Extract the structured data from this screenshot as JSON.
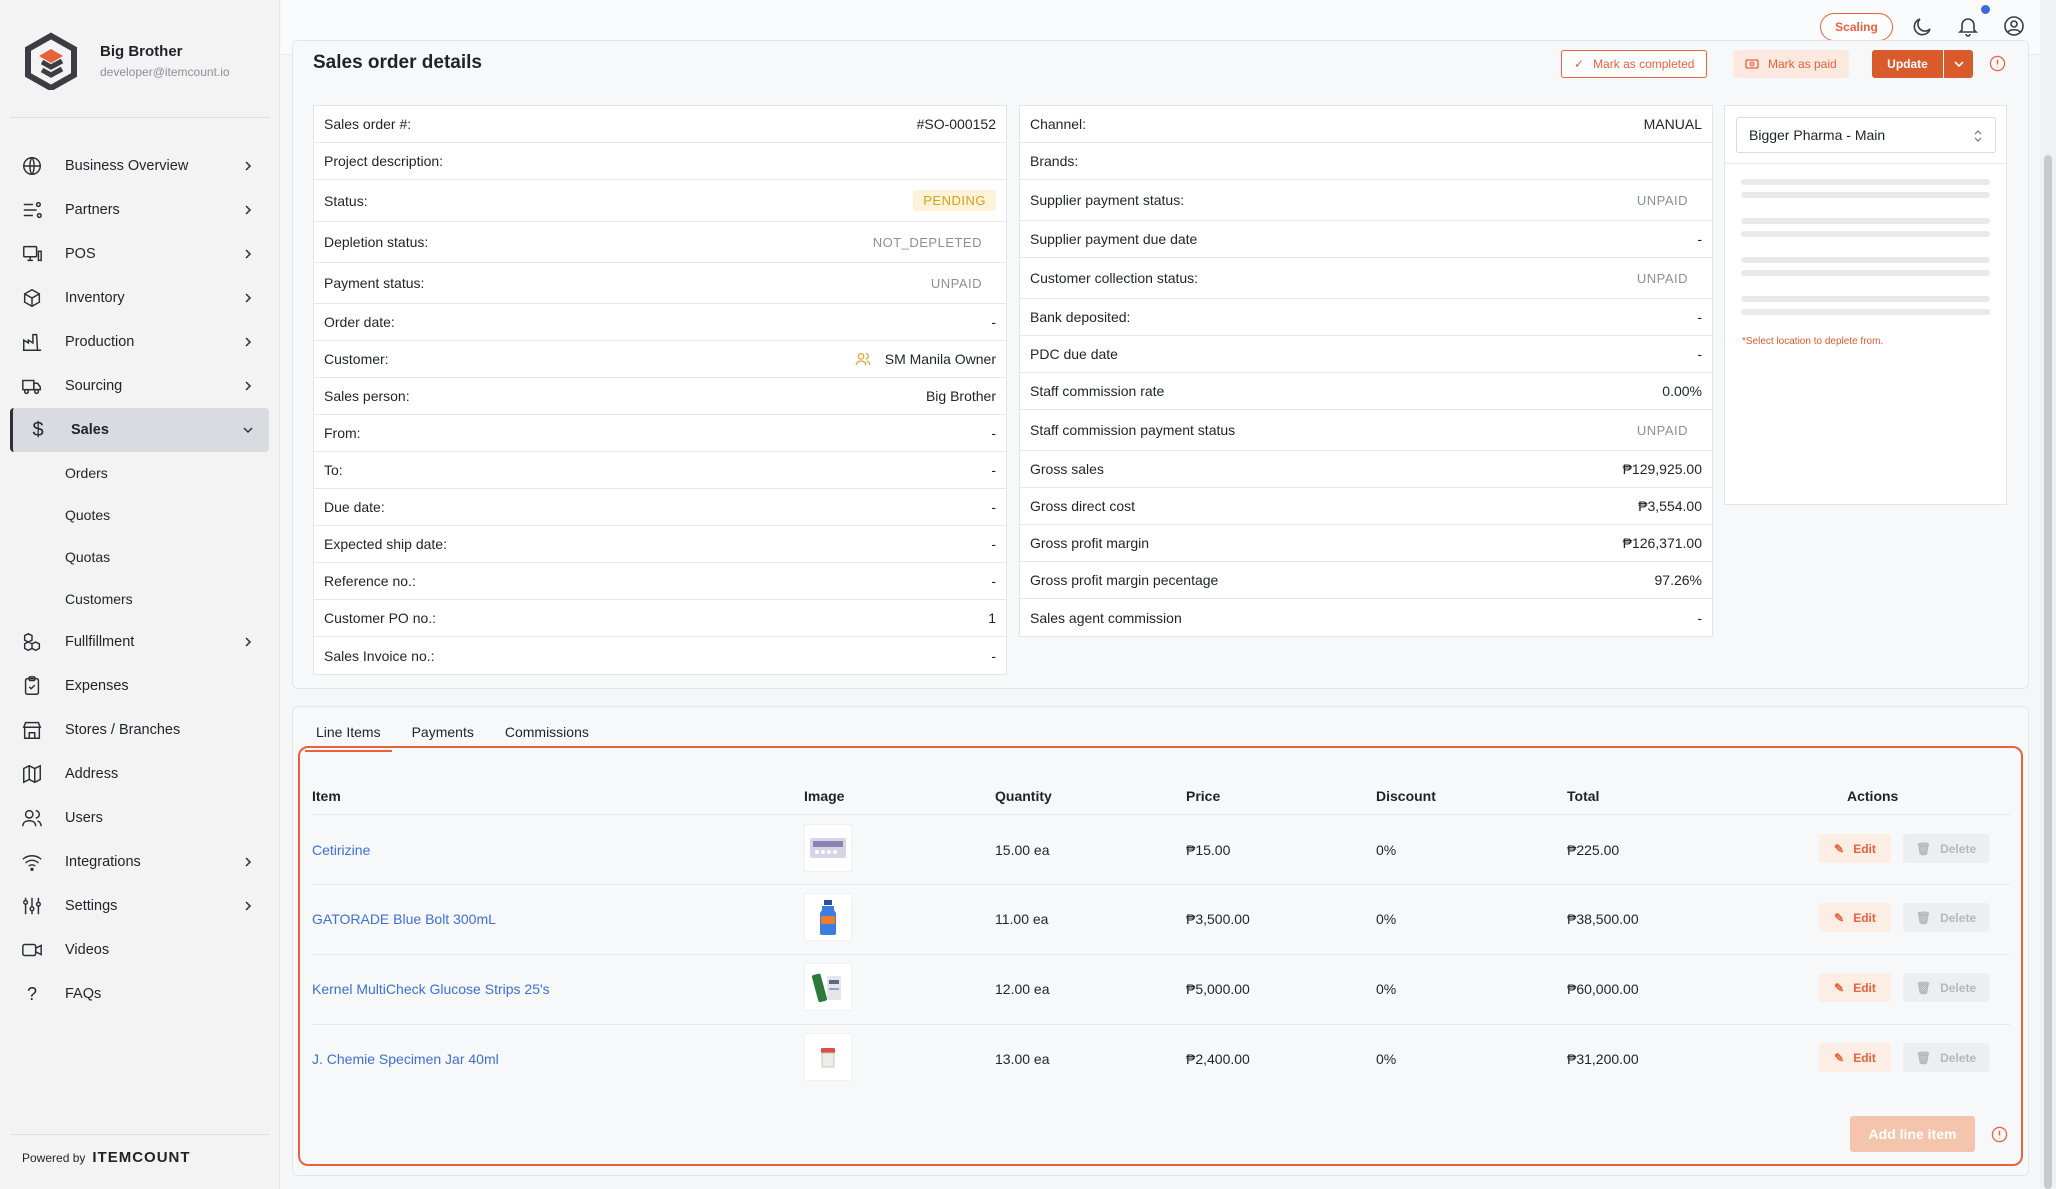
{
  "brand": {
    "name": "Big Brother",
    "email": "developer@itemcount.io"
  },
  "sidebar": {
    "items": [
      {
        "label": "Business Overview",
        "icon": "globe-icon"
      },
      {
        "label": "Partners",
        "icon": "partners-icon"
      },
      {
        "label": "POS",
        "icon": "pos-icon"
      },
      {
        "label": "Inventory",
        "icon": "box-icon"
      },
      {
        "label": "Production",
        "icon": "factory-icon"
      },
      {
        "label": "Sourcing",
        "icon": "truck-icon"
      },
      {
        "label": "Sales",
        "icon": "dollar-icon"
      },
      {
        "label": "Fullfillment",
        "icon": "boxes-icon"
      },
      {
        "label": "Expenses",
        "icon": "clipboard-icon"
      },
      {
        "label": "Stores / Branches",
        "icon": "store-icon"
      },
      {
        "label": "Address",
        "icon": "map-icon"
      },
      {
        "label": "Users",
        "icon": "users-icon"
      },
      {
        "label": "Integrations",
        "icon": "wifi-icon"
      },
      {
        "label": "Settings",
        "icon": "sliders-icon"
      },
      {
        "label": "Videos",
        "icon": "video-icon"
      },
      {
        "label": "FAQs",
        "icon": "question-icon"
      }
    ],
    "sales_sub": [
      "Orders",
      "Quotes",
      "Quotas",
      "Customers"
    ],
    "powered_by": "Powered by",
    "powered_brand": "ITEMCOUNT"
  },
  "topbar": {
    "scaling": "Scaling"
  },
  "page": {
    "title": "Sales order details",
    "mark_completed": "Mark as completed",
    "mark_paid": "Mark as paid",
    "update": "Update"
  },
  "details_left": [
    {
      "label": "Sales order #:",
      "value": "#SO-000152"
    },
    {
      "label": "Project description:",
      "value": ""
    },
    {
      "label": "Status:",
      "value": "PENDING"
    },
    {
      "label": "Depletion status:",
      "value": "NOT_DEPLETED"
    },
    {
      "label": "Payment status:",
      "value": "UNPAID"
    },
    {
      "label": "Order date:",
      "value": "-"
    },
    {
      "label": "Customer:",
      "value": "SM Manila Owner"
    },
    {
      "label": "Sales person:",
      "value": "Big Brother"
    },
    {
      "label": "From:",
      "value": "-"
    },
    {
      "label": "To:",
      "value": "-"
    },
    {
      "label": "Due date:",
      "value": "-"
    },
    {
      "label": "Expected ship date:",
      "value": "-"
    },
    {
      "label": "Reference no.:",
      "value": "-"
    },
    {
      "label": "Customer PO no.:",
      "value": "1"
    },
    {
      "label": "Sales Invoice no.:",
      "value": "-"
    }
  ],
  "details_right": [
    {
      "label": "Channel:",
      "value": "MANUAL"
    },
    {
      "label": "Brands:",
      "value": ""
    },
    {
      "label": "Supplier payment status:",
      "value": "UNPAID"
    },
    {
      "label": "Supplier payment due date",
      "value": "-"
    },
    {
      "label": "Customer collection status:",
      "value": "UNPAID"
    },
    {
      "label": "Bank deposited:",
      "value": "-"
    },
    {
      "label": "PDC due date",
      "value": "-"
    },
    {
      "label": "Staff commission rate",
      "value": "0.00%"
    },
    {
      "label": "Staff commission payment status",
      "value": "UNPAID"
    },
    {
      "label": "Gross sales",
      "value": "₱129,925.00"
    },
    {
      "label": "Gross direct cost",
      "value": "₱3,554.00"
    },
    {
      "label": "Gross profit margin",
      "value": "₱126,371.00"
    },
    {
      "label": "Gross profit margin pecentage",
      "value": "97.26%"
    },
    {
      "label": "Sales agent commission",
      "value": "-"
    }
  ],
  "location": {
    "selected": "Bigger Pharma - Main",
    "hint": "*Select location to deplete from."
  },
  "tabs": [
    "Line Items",
    "Payments",
    "Commissions"
  ],
  "line_items": {
    "headers": [
      "Item",
      "Image",
      "Quantity",
      "Price",
      "Discount",
      "Total",
      "Actions"
    ],
    "rows": [
      {
        "item": "Cetirizine",
        "quantity": "15.00 ea",
        "price": "₱15.00",
        "discount": "0%",
        "total": "₱225.00"
      },
      {
        "item": "GATORADE Blue Bolt 300mL",
        "quantity": "11.00 ea",
        "price": "₱3,500.00",
        "discount": "0%",
        "total": "₱38,500.00"
      },
      {
        "item": "Kernel MultiCheck Glucose Strips 25's",
        "quantity": "12.00 ea",
        "price": "₱5,000.00",
        "discount": "0%",
        "total": "₱60,000.00"
      },
      {
        "item": "J. Chemie Specimen Jar 40ml",
        "quantity": "13.00 ea",
        "price": "₱2,400.00",
        "discount": "0%",
        "total": "₱31,200.00"
      }
    ],
    "edit_label": "Edit",
    "delete_label": "Delete",
    "add_label": "Add line item"
  },
  "colors": {
    "accent": "#e8623a",
    "link": "#3d6fd6",
    "pending": "#d4a11b"
  }
}
